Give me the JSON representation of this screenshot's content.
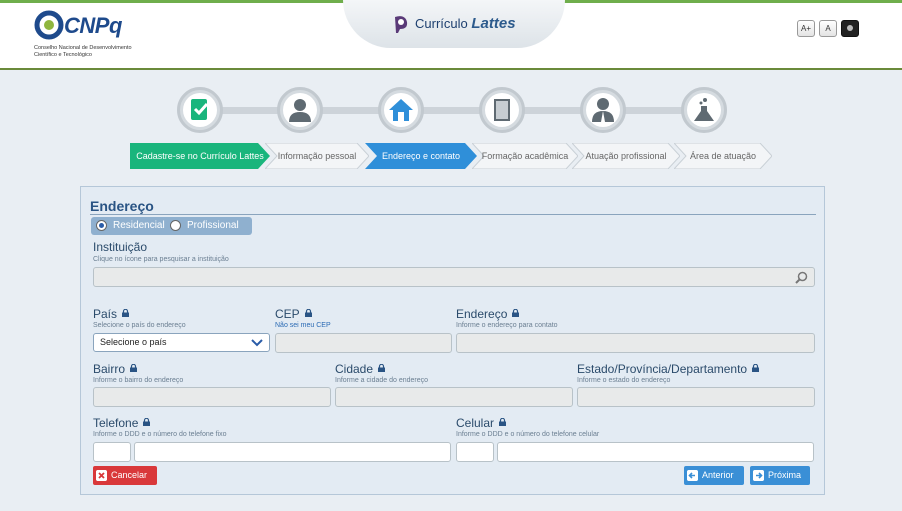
{
  "header": {
    "logo_text": "CNPq",
    "logo_subtitle": "Conselho Nacional de Desenvolvimento Científico e Tecnológico",
    "app_prefix": "Currículo",
    "app_name": "Lattes",
    "font_increase": "A+",
    "font_reset": "A"
  },
  "steps": [
    {
      "label": "Cadastre-se no Currículo Lattes",
      "icon": "checklist-icon",
      "state": "done"
    },
    {
      "label": "Informação pessoal",
      "icon": "person-icon",
      "state": "pending"
    },
    {
      "label": "Endereço e contato",
      "icon": "home-icon",
      "state": "current"
    },
    {
      "label": "Formação acadêmica",
      "icon": "book-icon",
      "state": "pending"
    },
    {
      "label": "Atuação profissional",
      "icon": "professional-icon",
      "state": "pending"
    },
    {
      "label": "Área de atuação",
      "icon": "flask-icon",
      "state": "pending"
    }
  ],
  "form": {
    "title": "Endereço",
    "radio_residencial": "Residencial",
    "radio_profissional": "Profissional",
    "selected": "Residencial",
    "instituicao": {
      "label": "Instituição",
      "hint": "Clique no ícone para pesquisar a instituição",
      "value": ""
    },
    "pais": {
      "label": "País",
      "hint": "Selecione o país do endereço",
      "selected": "Selecione o país"
    },
    "cep": {
      "label": "CEP",
      "hint": "Não sei meu CEP",
      "value": ""
    },
    "endereco": {
      "label": "Endereço",
      "hint": "Informe o endereço para contato",
      "value": ""
    },
    "bairro": {
      "label": "Bairro",
      "hint": "Informe o bairro do endereço",
      "value": ""
    },
    "cidade": {
      "label": "Cidade",
      "hint": "Informe a cidade do endereço",
      "value": ""
    },
    "estado": {
      "label": "Estado/Província/Departamento",
      "hint": "Informe o estado do endereço",
      "value": ""
    },
    "telefone": {
      "label": "Telefone",
      "hint": "Informe o DDD e o número do telefone fixo",
      "ddd": "",
      "numero": ""
    },
    "celular": {
      "label": "Celular",
      "hint": "Informe o DDD e o número do telefone celular",
      "ddd": "",
      "numero": ""
    }
  },
  "buttons": {
    "cancel": "Cancelar",
    "previous": "Anterior",
    "next": "Próxima"
  },
  "colors": {
    "step_done": "#19b57c",
    "step_current": "#2f8fd9",
    "cancel": "#d9383a",
    "nav": "#3a8fd6"
  }
}
